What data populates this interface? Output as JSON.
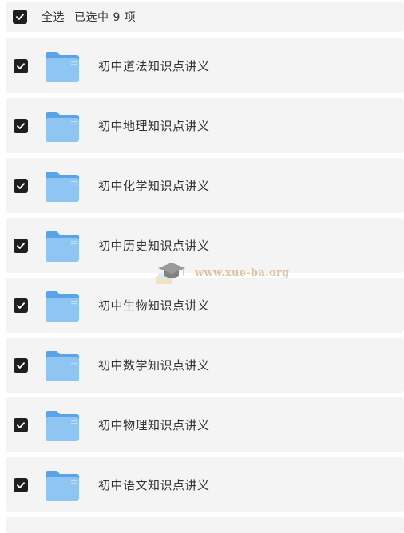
{
  "header": {
    "select_all_label": "全选",
    "selected_text": "已选中  9  项",
    "checked": true
  },
  "items": [
    {
      "name": "初中道法知识点讲义",
      "checked": true
    },
    {
      "name": "初中地理知识点讲义",
      "checked": true
    },
    {
      "name": "初中化学知识点讲义",
      "checked": true
    },
    {
      "name": "初中历史知识点讲义",
      "checked": true
    },
    {
      "name": "初中生物知识点讲义",
      "checked": true
    },
    {
      "name": "初中数学知识点讲义",
      "checked": true
    },
    {
      "name": "初中物理知识点讲义",
      "checked": true
    },
    {
      "name": "初中语文知识点讲义",
      "checked": true
    }
  ],
  "watermark": {
    "text": "www.xue-ba.org",
    "icon": "graduation-cap-icon"
  },
  "colors": {
    "row_bg": "#f4f4f4",
    "checkbox": "#1f1f1f",
    "folder": "#7ab8ef",
    "watermark": "#d9b98f"
  }
}
